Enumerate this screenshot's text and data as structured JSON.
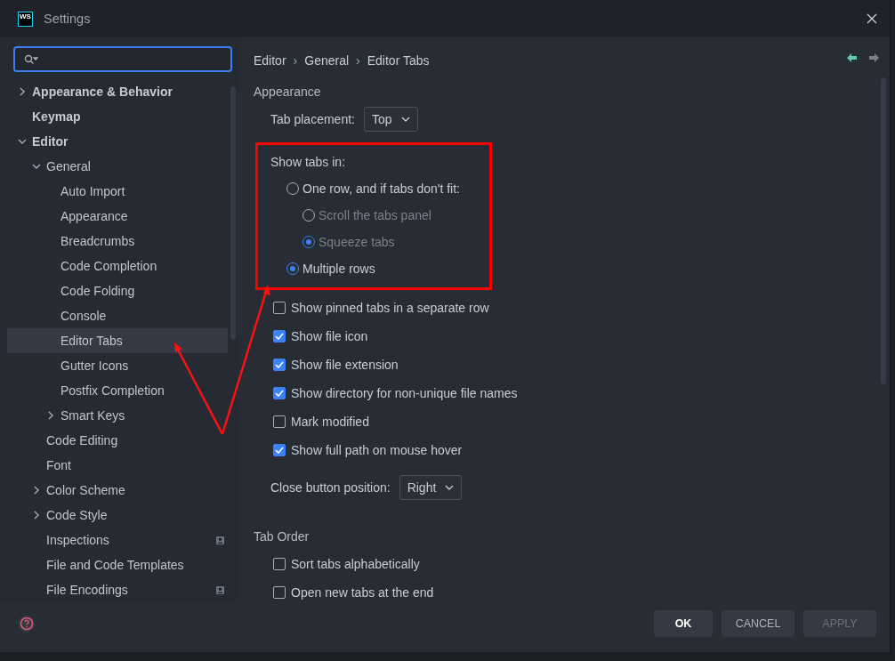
{
  "window": {
    "title": "Settings",
    "logo": "WS"
  },
  "tree": [
    {
      "label": "Appearance & Behavior",
      "expanded": false,
      "selected": false,
      "bold": true
    },
    {
      "label": "Keymap",
      "selected": false,
      "bold": true
    },
    {
      "label": "Editor",
      "expanded": true,
      "selected": false,
      "bold": true,
      "children": [
        {
          "label": "General",
          "expanded": true,
          "selected": false,
          "children": [
            {
              "label": "Auto Import",
              "selected": false
            },
            {
              "label": "Appearance",
              "selected": false
            },
            {
              "label": "Breadcrumbs",
              "selected": false
            },
            {
              "label": "Code Completion",
              "selected": false
            },
            {
              "label": "Code Folding",
              "selected": false
            },
            {
              "label": "Console",
              "selected": false
            },
            {
              "label": "Editor Tabs",
              "selected": true
            },
            {
              "label": "Gutter Icons",
              "selected": false
            },
            {
              "label": "Postfix Completion",
              "selected": false
            },
            {
              "label": "Smart Keys",
              "expanded": false,
              "selected": false
            }
          ]
        },
        {
          "label": "Code Editing",
          "selected": false
        },
        {
          "label": "Font",
          "selected": false
        },
        {
          "label": "Color Scheme",
          "expanded": false,
          "selected": false
        },
        {
          "label": "Code Style",
          "expanded": false,
          "selected": false
        },
        {
          "label": "Inspections",
          "selected": false,
          "badge": true
        },
        {
          "label": "File and Code Templates",
          "selected": false
        },
        {
          "label": "File Encodings",
          "selected": false,
          "badge": true
        }
      ]
    }
  ],
  "breadcrumb": {
    "separator": "›",
    "items": [
      "Editor",
      "General",
      "Editor Tabs"
    ]
  },
  "appearance": {
    "title": "Appearance",
    "tab_placement": {
      "label": "Tab placement:",
      "value": "Top"
    },
    "show_tabs_in": {
      "label": "Show tabs in:",
      "options": [
        {
          "label": "One row, and if tabs don't fit:",
          "selected": false,
          "disabled": false,
          "children": [
            {
              "label": "Scroll the tabs panel",
              "selected": false,
              "disabled": true
            },
            {
              "label": "Squeeze tabs",
              "selected": true,
              "disabled": true
            }
          ]
        },
        {
          "label": "Multiple rows",
          "selected": true,
          "disabled": false
        }
      ]
    },
    "checkboxes": [
      {
        "label": "Show pinned tabs in a separate row",
        "checked": false
      },
      {
        "label": "Show file icon",
        "checked": true
      },
      {
        "label": "Show file extension",
        "checked": true
      },
      {
        "label": "Show directory for non-unique file names",
        "checked": true
      },
      {
        "label": "Mark modified",
        "checked": false
      },
      {
        "label": "Show full path on mouse hover",
        "checked": true
      }
    ],
    "close_button_position": {
      "label": "Close button position:",
      "value": "Right"
    }
  },
  "tab_order": {
    "title": "Tab Order",
    "checkboxes": [
      {
        "label": "Sort tabs alphabetically",
        "checked": false
      },
      {
        "label": "Open new tabs at the end",
        "checked": false
      }
    ]
  },
  "buttons": [
    {
      "label": "OK",
      "disabled": false,
      "default": true
    },
    {
      "label": "CANCEL",
      "disabled": false,
      "default": false
    },
    {
      "label": "APPLY",
      "disabled": true,
      "default": false
    }
  ]
}
